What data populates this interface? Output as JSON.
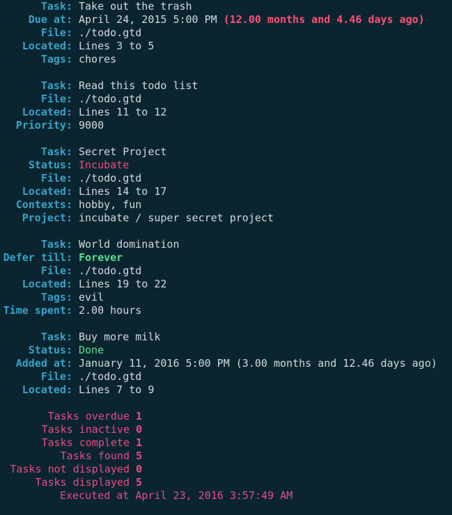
{
  "tasks": [
    {
      "task_label": "Task:",
      "task": "Take out the trash",
      "due_label": "Due at:",
      "due": "April 24, 2015 5:00 PM",
      "due_rel": "(12.00 months and 4.46 days ago)",
      "file_label": "File:",
      "file": "./todo.gtd",
      "located_label": "Located:",
      "located": "Lines 3 to 5",
      "tags_label": "Tags:",
      "tags": "chores"
    },
    {
      "task_label": "Task:",
      "task": "Read this todo list",
      "file_label": "File:",
      "file": "./todo.gtd",
      "located_label": "Located:",
      "located": "Lines 11 to 12",
      "priority_label": "Priority:",
      "priority": "9000"
    },
    {
      "task_label": "Task:",
      "task": "Secret Project",
      "status_label": "Status:",
      "status": "Incubate",
      "file_label": "File:",
      "file": "./todo.gtd",
      "located_label": "Located:",
      "located": "Lines 14 to 17",
      "contexts_label": "Contexts:",
      "contexts": "hobby, fun",
      "project_label": "Project:",
      "project": "incubate / super secret project"
    },
    {
      "task_label": "Task:",
      "task": "World domination",
      "defer_label": "Defer till:",
      "defer": "Forever",
      "file_label": "File:",
      "file": "./todo.gtd",
      "located_label": "Located:",
      "located": "Lines 19 to 22",
      "tags_label": "Tags:",
      "tags": "evil",
      "time_label": "Time spent:",
      "time": "2.00 hours"
    },
    {
      "task_label": "Task:",
      "task": "Buy more milk",
      "status_label": "Status:",
      "status": "Done",
      "added_label": "Added at:",
      "added": "January 11, 2016 5:00 PM (3.00 months and 12.46 days ago)",
      "file_label": "File:",
      "file": "./todo.gtd",
      "located_label": "Located:",
      "located": "Lines 7 to 9"
    }
  ],
  "summary": [
    {
      "label": "Tasks overdue",
      "value": "1"
    },
    {
      "label": "Tasks inactive",
      "value": "0"
    },
    {
      "label": "Tasks complete",
      "value": "1"
    },
    {
      "label": "Tasks found",
      "value": "5"
    },
    {
      "label": "Tasks not displayed",
      "value": "0"
    },
    {
      "label": "Tasks displayed",
      "value": "5"
    }
  ],
  "executed": "Executed at April 23, 2016 3:57:49 AM",
  "colors": {
    "background": "#0b2530",
    "key": "#38a3c8",
    "text": "#d3d9dc",
    "magenta": "#e94b86",
    "overdue_red": "#ff4f74",
    "green": "#53e28f"
  }
}
